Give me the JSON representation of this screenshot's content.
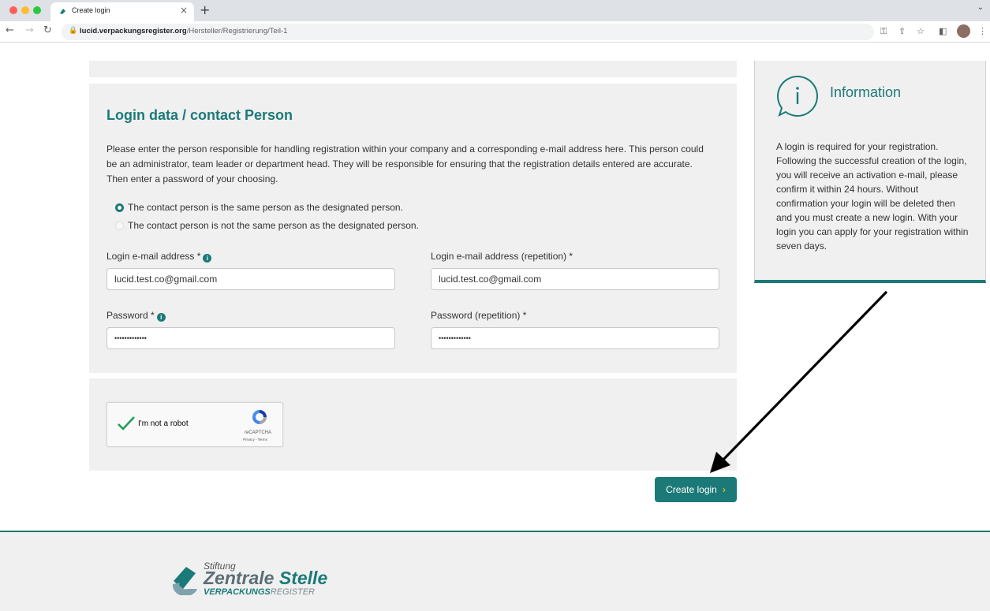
{
  "browser": {
    "tab_title": "Create login",
    "url_host": "lucid.verpackungsregister.org",
    "url_path": "/Hersteller/Registrierung/Teil-1"
  },
  "form": {
    "heading": "Login data / contact Person",
    "intro": "Please enter the person responsible for handling registration within your company and a corresponding e-mail address here. This person could be an administrator, team leader or department head. They will be responsible for ensuring that the registration details entered are accurate. Then enter a password of your choosing.",
    "radio_options": [
      "The contact person is the same person as the designated person.",
      "The contact person is not the same person as the designated person."
    ],
    "selected_radio": 0,
    "email_label": "Login e-mail address *",
    "email_value": "lucid.test.co@gmail.com",
    "email_repeat_label": "Login e-mail address (repetition) *",
    "email_repeat_value": "lucid.test.co@gmail.com",
    "password_label": "Password *",
    "password_value": "•••••••••••••",
    "password_repeat_label": "Password (repetition) *",
    "password_repeat_value": "•••••••••••••",
    "submit_label": "Create login"
  },
  "captcha": {
    "label": "I'm not a robot",
    "brand": "reCAPTCHA",
    "links": "Privacy - Terms",
    "checked": true
  },
  "info": {
    "title": "Information",
    "text": "A login is required for your registration. Following the successful creation of the login, you will receive an activation e-mail, please confirm it within 24 hours. Without confirmation your login will be deleted then and you must create a new login. With your login you can apply for your registration within seven days."
  },
  "footer": {
    "logo_line1": "Stiftung",
    "logo_line2a": "Zentrale",
    "logo_line2b": "Stelle",
    "logo_line3a": "VERPACKUNGS",
    "logo_line3b": "REGISTER"
  },
  "colors": {
    "accent": "#1b7a78",
    "panel_bg": "#f0f0f0",
    "button_chevron": "#f5b400"
  }
}
